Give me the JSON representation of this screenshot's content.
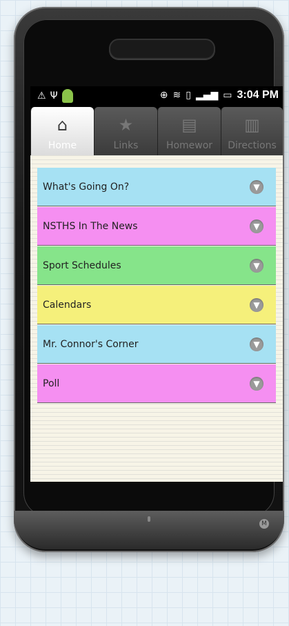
{
  "status_bar": {
    "time": "3:04 PM",
    "icons": [
      "warning-icon",
      "usb-icon",
      "android-icon",
      "location-icon",
      "wifi-icon",
      "vibrate-icon",
      "signal-icon",
      "battery-icon"
    ]
  },
  "tabs": [
    {
      "label": "Home",
      "icon": "home-icon",
      "active": true
    },
    {
      "label": "Links",
      "icon": "star-icon",
      "active": false
    },
    {
      "label": "Homewor",
      "icon": "document-icon",
      "active": false
    },
    {
      "label": "Directions",
      "icon": "inbox-icon",
      "active": false
    }
  ],
  "menu": [
    {
      "label": "What's Going On?",
      "color": "#a6e1f3"
    },
    {
      "label": "NSTHS In The News",
      "color": "#f58ff1"
    },
    {
      "label": "Sport Schedules",
      "color": "#86e48a"
    },
    {
      "label": "Calendars",
      "color": "#f5f07b"
    },
    {
      "label": "Mr. Connor's Corner",
      "color": "#a6e1f3"
    },
    {
      "label": "Poll",
      "color": "#f58ff1"
    }
  ]
}
